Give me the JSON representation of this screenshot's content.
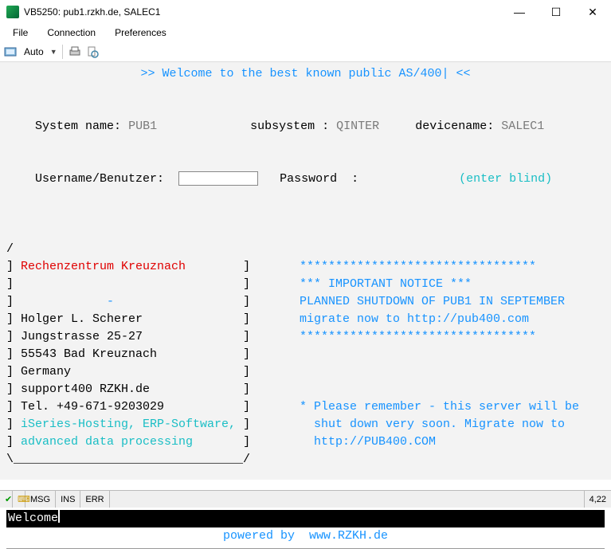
{
  "window": {
    "title": "VB5250: pub1.rzkh.de, SALEC1"
  },
  "menubar": [
    "File",
    "Connection",
    "Preferences"
  ],
  "toolbar": {
    "mode": "Auto"
  },
  "terminal": {
    "welcome": ">> Welcome to the best known public AS/400| <<",
    "system_name_label": "System name:",
    "system_name": "PUB1",
    "subsystem_label": "subsystem :",
    "subsystem": "QINTER",
    "devicename_label": "devicename:",
    "devicename": "SALEC1",
    "username_label": "Username/Benutzer:",
    "password_label": "Password  :",
    "enter_blind": "(enter blind)",
    "left_col": [
      {
        "t": "/",
        "c": ""
      },
      {
        "t": "] Rechenzentrum Kreuznach        ]",
        "c": "c-red",
        "plainPrefix": "] ",
        "plainSuffix": "        ]"
      },
      {
        "t": "]                                ]",
        "c": ""
      },
      {
        "t": "]             -                  ]",
        "c": "c-blue",
        "plainPrefix": "]             ",
        "plainSuffix": "                  ]"
      },
      {
        "t": "] Holger L. Scherer              ]",
        "c": ""
      },
      {
        "t": "] Jungstrasse 25-27              ]",
        "c": ""
      },
      {
        "t": "] 55543 Bad Kreuznach            ]",
        "c": ""
      },
      {
        "t": "] Germany                        ]",
        "c": ""
      },
      {
        "t": "] support400 RZKH.de             ]",
        "c": ""
      },
      {
        "t": "] Tel. +49-671-9203029           ]",
        "c": ""
      },
      {
        "t": "] iSeries-Hosting, ERP-Software, ]",
        "c": "c-cyan"
      },
      {
        "t": "] advanced data processing       ]",
        "c": "c-cyan"
      },
      {
        "t": "\\________________________________/",
        "c": ""
      }
    ],
    "right_col": [
      "",
      "  *********************************",
      "  *** IMPORTANT NOTICE ***",
      "  PLANNED SHUTDOWN OF PUB1 IN SEPTEMBER",
      "  migrate now to http://pub400.com",
      "  *********************************",
      "",
      "",
      "",
      "  * Please remember - this server will be",
      "    shut down very soon. Migrate now to",
      "    http://PUB400.COM",
      ""
    ],
    "status_prompt": "Welcome",
    "powered_by": "powered by  www.RZKH.de"
  },
  "statusbar": {
    "msg": "MSG",
    "ins": "INS",
    "err": "ERR",
    "pos": "4,22"
  }
}
